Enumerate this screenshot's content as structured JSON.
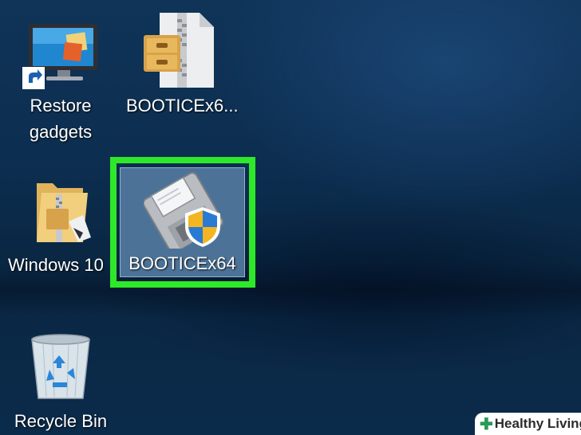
{
  "desktop": {
    "icons": [
      {
        "label": "Restore\ngadgets",
        "icon": "monitor-shortcut-icon"
      },
      {
        "label": "BOOTICEx6...",
        "icon": "zip-archive-icon"
      },
      {
        "label": "Windows 10",
        "icon": "zip-folder-icon"
      },
      {
        "label": "BOOTICEx64",
        "icon": "floppy-shield-icon",
        "selected": true
      },
      {
        "label": "Recycle Bin",
        "icon": "recycle-bin-icon"
      }
    ]
  },
  "watermark": {
    "text": "Healthy Living",
    "icon": "plus-icon",
    "accent": "#2a9a5a"
  },
  "colors": {
    "highlight": "#2ee82a",
    "selection": "#4c7397",
    "desktop": "#0c2d4f"
  }
}
